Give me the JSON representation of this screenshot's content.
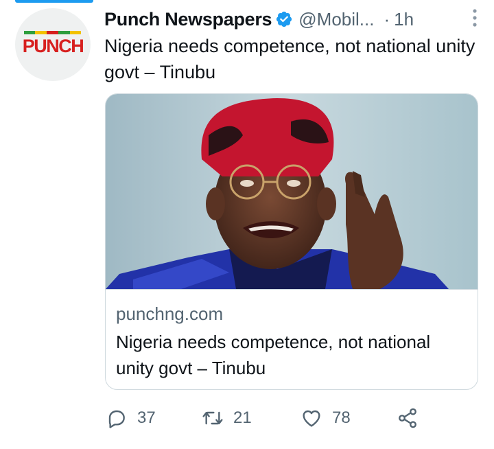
{
  "account": {
    "name": "Punch Newspapers",
    "handle": "@Mobil...",
    "separator": "·",
    "time": "1h",
    "logo_text": "PUNCH"
  },
  "tweet": {
    "text": "Nigeria needs competence, not national unity govt – Tinubu"
  },
  "card": {
    "domain": "punchng.com",
    "title": "Nigeria needs competence, not national unity govt – Tinubu"
  },
  "actions": {
    "replies": "37",
    "retweets": "21",
    "likes": "78"
  },
  "icons": {
    "verified": "verified-badge-icon",
    "more": "more-vertical-icon",
    "reply": "reply-icon",
    "retweet": "retweet-icon",
    "like": "heart-icon",
    "share": "share-icon"
  },
  "colors": {
    "accent": "#1d9bf0",
    "brand_red": "#d7201f",
    "muted": "#536471",
    "text": "#0f1419"
  }
}
